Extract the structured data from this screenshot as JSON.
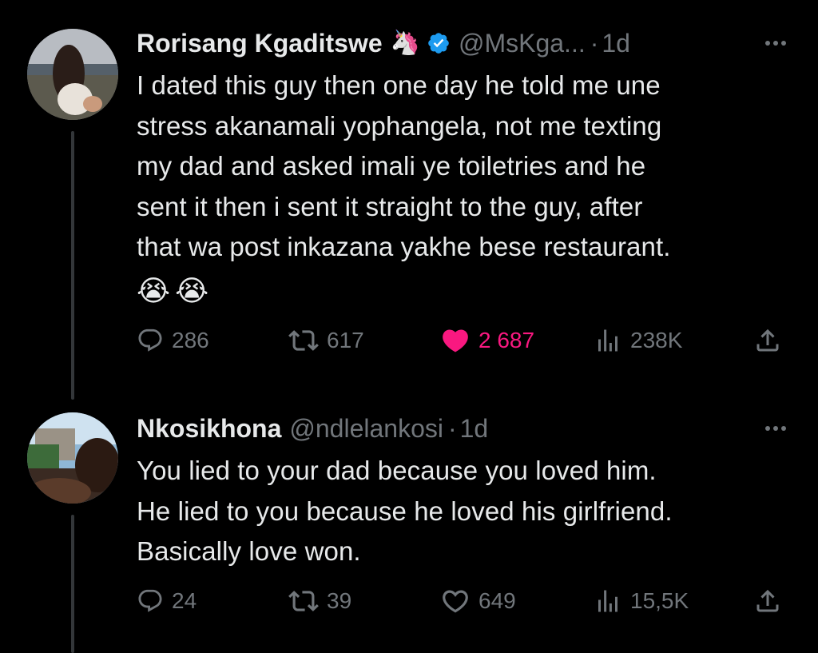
{
  "tweets": [
    {
      "display_name": "Rorisang Kgaditswe",
      "badge_emoji": "🦄",
      "verified": true,
      "handle": "@MsKga...",
      "separator": "·",
      "time": "1d",
      "text": "I dated this guy then one day he told me une\nstress akanamali yophangela, not me texting\nmy dad and asked imali ye toiletries and he\nsent it then i sent it straight to the guy, after\nthat wa post inkazana yakhe bese restaurant.",
      "emojis": "😭😭",
      "replies": "286",
      "reposts": "617",
      "likes": "2 687",
      "liked": true,
      "views": "238K"
    },
    {
      "display_name": "Nkosikhona",
      "handle": "@ndlelankosi",
      "separator": "·",
      "time": "1d",
      "text": "You lied to your dad because you loved him.\nHe lied to you because he loved his girlfriend.\nBasically love won.",
      "replies": "24",
      "reposts": "39",
      "likes": "649",
      "liked": false,
      "views": "15,5K"
    }
  ],
  "colors": {
    "background": "#000000",
    "text": "#e7e9ea",
    "muted": "#71767b",
    "like": "#f91880",
    "verified": "#1d9bf0"
  },
  "icons": [
    "reply-icon",
    "repost-icon",
    "like-icon",
    "views-icon",
    "share-icon",
    "more-icon",
    "verified-icon"
  ]
}
